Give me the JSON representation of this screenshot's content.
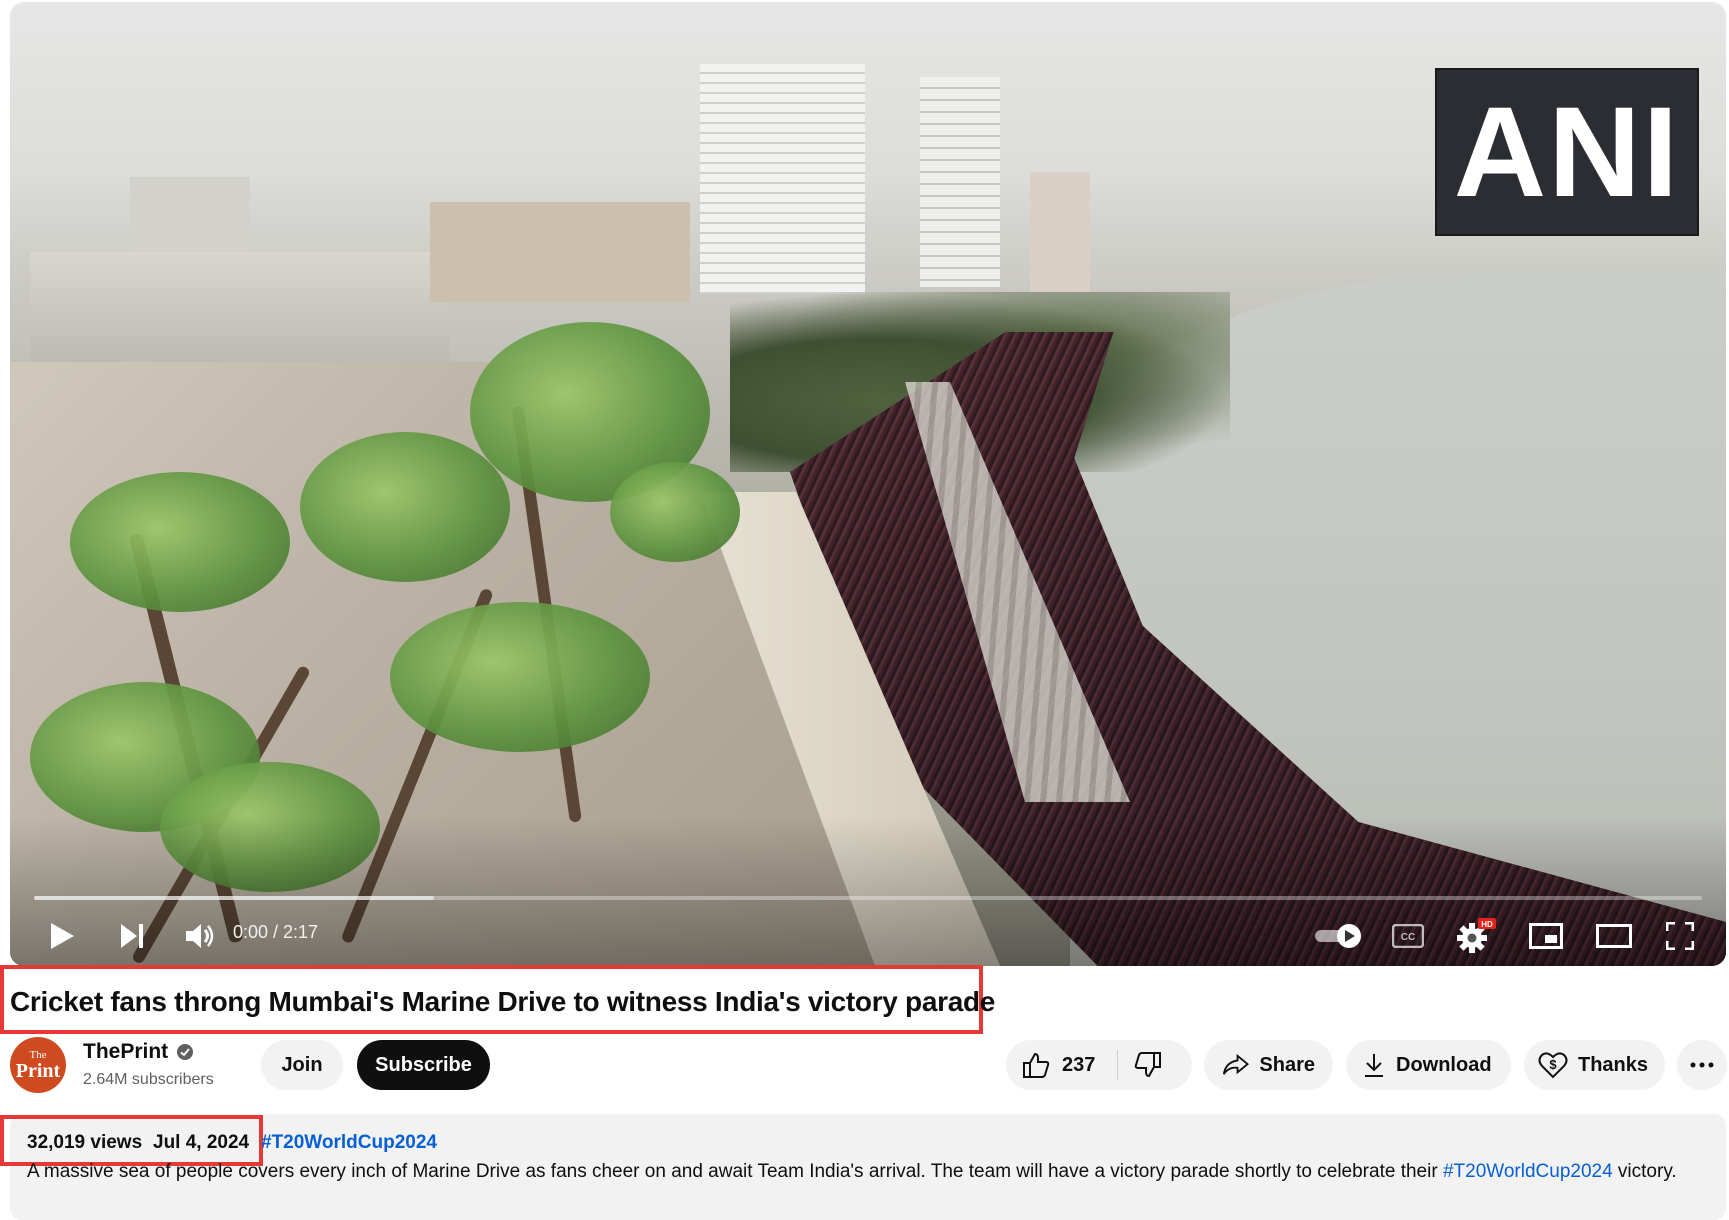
{
  "player": {
    "watermark": "ANI",
    "time_display": "0:00 / 2:17",
    "progress_buffered": 0.24,
    "controls": [
      "play-icon",
      "next-icon",
      "volume-icon",
      "autoplay-toggle-icon",
      "captions-icon",
      "settings-icon",
      "miniplayer-icon",
      "theater-icon",
      "fullscreen-icon"
    ],
    "settings_badge": "HD"
  },
  "video": {
    "title": "Cricket fans throng Mumbai's Marine Drive to witness India's victory parade"
  },
  "channel": {
    "avatar_top": "The",
    "avatar_bottom": "Print",
    "name": "ThePrint",
    "subscribers": "2.64M subscribers",
    "join_label": "Join",
    "subscribe_label": "Subscribe"
  },
  "actions": {
    "like_count": "237",
    "share_label": "Share",
    "download_label": "Download",
    "thanks_label": "Thanks"
  },
  "description": {
    "views": "32,019 views",
    "date": "Jul 4, 2024",
    "hashtag": "#T20WorldCup2024",
    "text_before_link": "A massive sea of people covers every inch of Marine Drive as fans cheer on and await Team India's arrival. The team will have a victory parade shortly to celebrate their ",
    "inline_link": "#T20WorldCup2024",
    "text_after_link": " victory."
  },
  "colors": {
    "highlight_box": "#e53935",
    "link_blue": "#065fd4",
    "subscribe_bg": "#0f0f0f",
    "pill_bg": "#f2f2f2"
  }
}
